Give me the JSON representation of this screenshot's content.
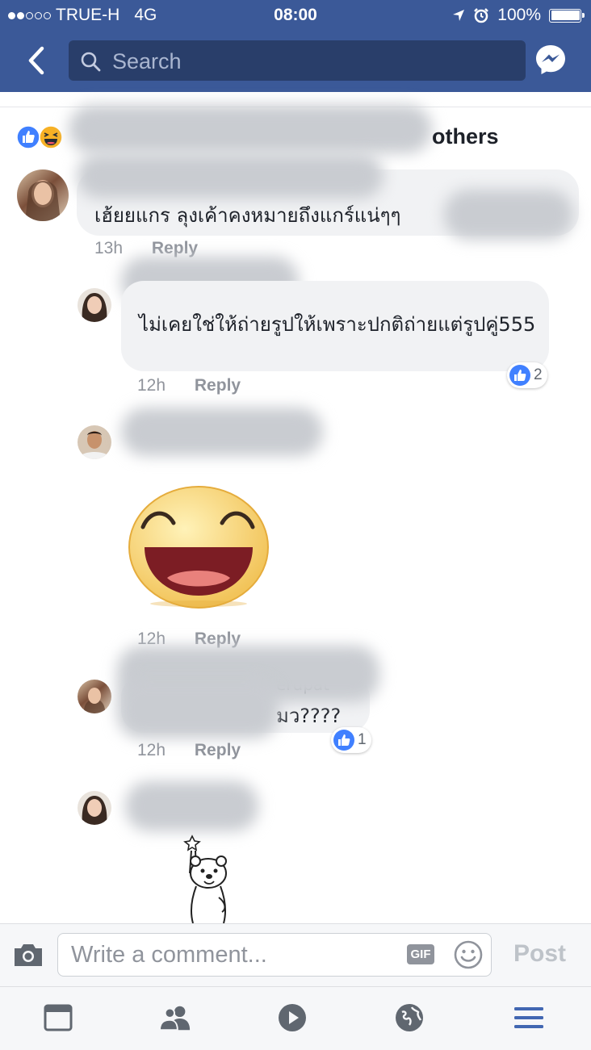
{
  "status_bar": {
    "carrier": "TRUE-H",
    "network": "4G",
    "time": "08:00",
    "battery": "100%"
  },
  "nav": {
    "search_placeholder": "Search"
  },
  "reactions": {
    "names_visible": "others",
    "icons": [
      "like-icon",
      "haha-icon"
    ]
  },
  "comments": [
    {
      "text": "เฮ้ยยแกร ลุงเค้าคงหมายถึงแกร์แน่ๆๆ",
      "time": "13h",
      "reply": "Reply"
    },
    {
      "text": "ไม่เคยใช่ให้ถ่ายรูปให้เพราะปกติถ่ายแต่รูปคู่555",
      "time": "12h",
      "reply": "Reply",
      "likes": "2"
    },
    {
      "sticker": "laughing-face-sticker",
      "time": "12h",
      "reply": "Reply"
    },
    {
      "text_tail_1": "erupat",
      "text_tail_2": "มว????",
      "time": "12h",
      "reply": "Reply",
      "likes": "1"
    },
    {
      "sticker": "bear-sticker"
    }
  ],
  "composer": {
    "placeholder": "Write a comment...",
    "gif_label": "GIF",
    "post_label": "Post"
  },
  "tabs": [
    "news-feed-icon",
    "friends-icon",
    "video-icon",
    "notifications-globe-icon",
    "menu-icon"
  ],
  "colors": {
    "brand": "#3b5998",
    "like_blue": "#4080ff",
    "bubble": "#f1f2f4",
    "muted": "#90949c"
  }
}
